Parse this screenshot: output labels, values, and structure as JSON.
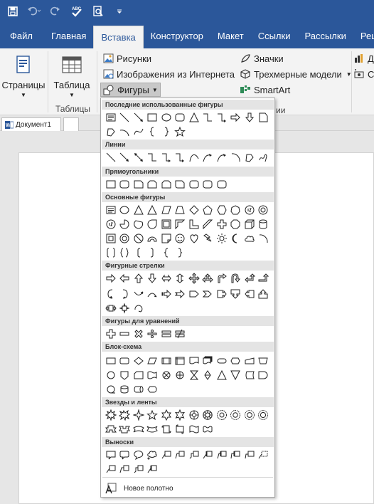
{
  "quick_access": {
    "icons": [
      "save-icon",
      "undo-icon",
      "redo-icon",
      "spelling-icon",
      "print-preview-icon",
      "customize-icon"
    ],
    "spelling_text": "ABC"
  },
  "tabs": [
    {
      "label": "Файл",
      "active": false
    },
    {
      "label": "Главная",
      "active": false
    },
    {
      "label": "Вставка",
      "active": true
    },
    {
      "label": "Конструктор",
      "active": false
    },
    {
      "label": "Макет",
      "active": false
    },
    {
      "label": "Ссылки",
      "active": false
    },
    {
      "label": "Рассылки",
      "active": false
    },
    {
      "label": "Рецен",
      "active": false
    }
  ],
  "ribbon": {
    "pages_label": "Страницы",
    "table_label": "Таблица",
    "tables_group": "Таблицы",
    "pictures": "Рисунки",
    "online_pictures": "Изображения из Интернета",
    "shapes": "Фигуры",
    "icons": "Значки",
    "models_3d": "Трехмерные модели",
    "smartart": "SmartArt",
    "partial_right_1": "Ди",
    "partial_right_2": "Сн",
    "partial_group": "ии"
  },
  "doc_tab": {
    "label": "Документ1"
  },
  "shapes_menu": {
    "sections": [
      {
        "title": "Последние использованные фигуры"
      },
      {
        "title": "Линии"
      },
      {
        "title": "Прямоугольники"
      },
      {
        "title": "Основные фигуры"
      },
      {
        "title": "Фигурные стрелки"
      },
      {
        "title": "Фигуры для уравнений"
      },
      {
        "title": "Блок-схема"
      },
      {
        "title": "Звезды и ленты"
      },
      {
        "title": "Выноски"
      }
    ],
    "new_canvas": "Новое полотно"
  },
  "colors": {
    "accent": "#2b579a",
    "ribbon_bg": "#f3f3f3",
    "header_bg": "#e4e4e4"
  }
}
